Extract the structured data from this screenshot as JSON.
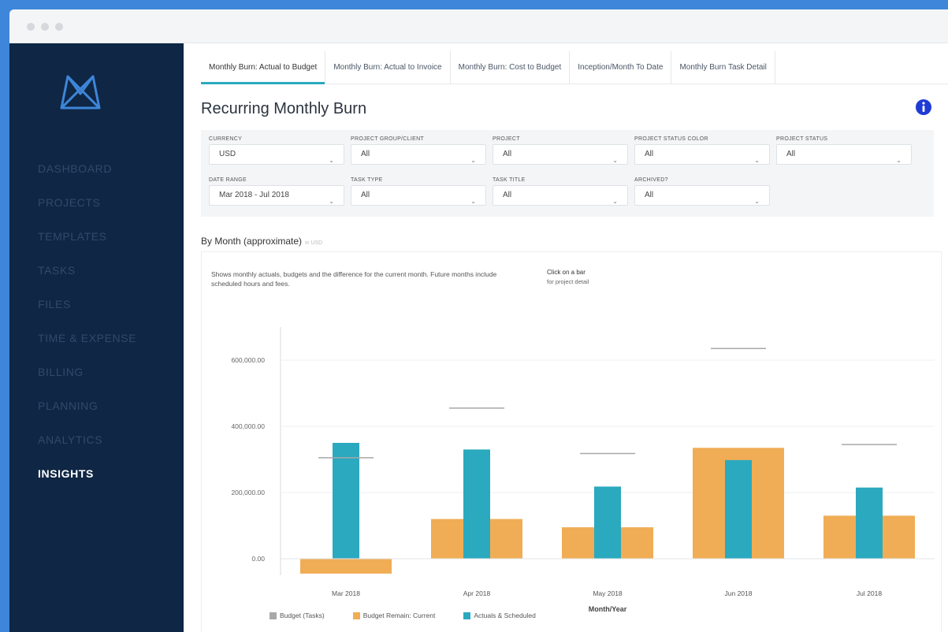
{
  "sidebar": {
    "items": [
      {
        "label": "DASHBOARD"
      },
      {
        "label": "PROJECTS"
      },
      {
        "label": "TEMPLATES"
      },
      {
        "label": "TASKS"
      },
      {
        "label": "FILES"
      },
      {
        "label": "TIME & EXPENSE"
      },
      {
        "label": "BILLING"
      },
      {
        "label": "PLANNING"
      },
      {
        "label": "ANALYTICS"
      },
      {
        "label": "INSIGHTS",
        "active": true
      }
    ]
  },
  "tabs": [
    {
      "label": "Monthly Burn: Actual to Budget",
      "active": true
    },
    {
      "label": "Monthly Burn: Actual to Invoice"
    },
    {
      "label": "Monthly Burn: Cost to Budget"
    },
    {
      "label": "Inception/Month To Date"
    },
    {
      "label": "Monthly Burn Task Detail"
    }
  ],
  "page": {
    "title": "Recurring Monthly Burn"
  },
  "filters": [
    {
      "label": "CURRENCY",
      "value": "USD"
    },
    {
      "label": "PROJECT GROUP/CLIENT",
      "value": "All"
    },
    {
      "label": "PROJECT",
      "value": "All"
    },
    {
      "label": "PROJECT STATUS COLOR",
      "value": "All"
    },
    {
      "label": "PROJECT STATUS",
      "value": "All"
    },
    {
      "label": "DATE RANGE",
      "value": "Mar 2018 - Jul 2018"
    },
    {
      "label": "TASK TYPE",
      "value": "All"
    },
    {
      "label": "TASK TITLE",
      "value": "All"
    },
    {
      "label": "ARCHIVED?",
      "value": "All"
    }
  ],
  "section": {
    "title": "By Month (approximate)",
    "note": "in USD"
  },
  "chart_panel": {
    "description": "Shows monthly actuals, budgets and the difference for the current month. Future months include scheduled hours and fees.",
    "hint_title": "Click on a bar",
    "hint_sub": "for project detail"
  },
  "chart_data": {
    "type": "bar",
    "categories": [
      "Mar 2018",
      "Apr 2018",
      "May 2018",
      "Jun 2018",
      "Jul 2018"
    ],
    "xlabel": "Month/Year",
    "ylabel": "",
    "ylim": [
      -50000,
      700000
    ],
    "yticks": [
      0,
      200000,
      400000,
      600000
    ],
    "ytick_labels": [
      "0.00",
      "200,000.00",
      "400,000.00",
      "600,000.00"
    ],
    "series": [
      {
        "name": "Budget (Tasks)",
        "values": [
          305000,
          455000,
          318000,
          635000,
          345000
        ],
        "color": "#a8a8a8",
        "style": "line-marker"
      },
      {
        "name": "Budget Remain: Current",
        "values": [
          -45000,
          120000,
          95000,
          335000,
          130000
        ],
        "color": "#f0ad55"
      },
      {
        "name": "Actuals & Scheduled",
        "values": [
          350000,
          330000,
          218000,
          298000,
          215000
        ],
        "color": "#2aa9bf"
      }
    ],
    "grid": true,
    "legend": "bottom"
  },
  "colors": {
    "sidebar_bg": "#0f2644",
    "accent": "#2aa9bf",
    "brand": "#3d86d9"
  },
  "icons": {
    "logo": "logo-icon",
    "info": "info-icon",
    "chevron": "chevron-down-icon"
  }
}
